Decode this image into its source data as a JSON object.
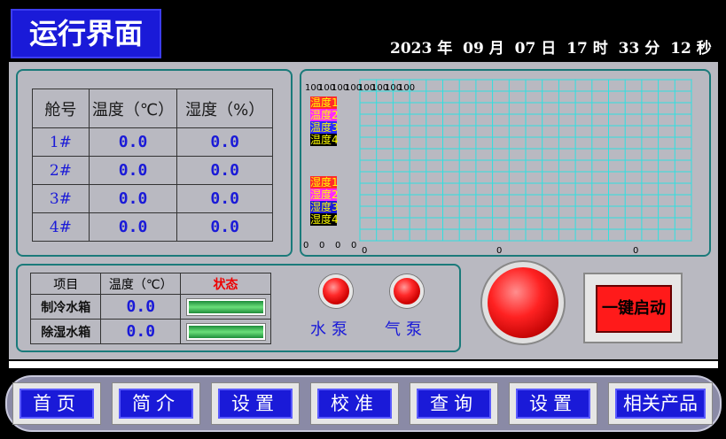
{
  "header": {
    "title": "运行界面",
    "datetime": [
      "2023 年",
      "09 月",
      "07 日",
      "17 时",
      "33 分",
      "12 秒"
    ]
  },
  "env_table": {
    "headers": [
      "舱号",
      "温度（℃）",
      "湿度（%）"
    ],
    "rows": [
      {
        "cabin": "1#",
        "temp": "0.0",
        "humidity": "0.0"
      },
      {
        "cabin": "2#",
        "temp": "0.0",
        "humidity": "0.0"
      },
      {
        "cabin": "3#",
        "temp": "0.0",
        "humidity": "0.0"
      },
      {
        "cabin": "4#",
        "temp": "0.0",
        "humidity": "0.0"
      }
    ]
  },
  "chart": {
    "y_max_labels": [
      "100",
      "100",
      "100",
      "100",
      "100",
      "100",
      "100",
      "100"
    ],
    "y_min_labels": [
      "0",
      "0",
      "0",
      "0",
      "0",
      "0",
      "0",
      "0"
    ],
    "x_labels": [
      "0",
      "0",
      "0"
    ],
    "legend_temp": [
      {
        "label": "温度1",
        "color": "#ff2a2a"
      },
      {
        "label": "温度2",
        "color": "#ff2aff"
      },
      {
        "label": "温度3",
        "color": "#2a2aff"
      },
      {
        "label": "温度4",
        "color": "#000000"
      }
    ],
    "legend_hum": [
      {
        "label": "湿度1",
        "color": "#ff2a2a"
      },
      {
        "label": "湿度2",
        "color": "#ff2aff"
      },
      {
        "label": "湿度3",
        "color": "#1a1ad8"
      },
      {
        "label": "湿度4",
        "color": "#000000"
      }
    ]
  },
  "status_table": {
    "headers": [
      "项目",
      "温度（℃）",
      "状态"
    ],
    "rows": [
      {
        "name": "制冷水箱",
        "temp": "0.0"
      },
      {
        "name": "除湿水箱",
        "temp": "0.0"
      }
    ]
  },
  "pumps": [
    {
      "label": "水泵"
    },
    {
      "label": "气泵"
    }
  ],
  "start_button": {
    "label": "一键启动"
  },
  "nav": [
    "首页",
    "简介",
    "设置",
    "校准",
    "查询",
    "设置",
    "相关产品"
  ],
  "colors": {
    "accent_blue": "#1a1ad8",
    "panel_bg": "#b9b9c1",
    "lamp_red": "#ff2a2a",
    "border_teal": "#1a7a7a"
  }
}
